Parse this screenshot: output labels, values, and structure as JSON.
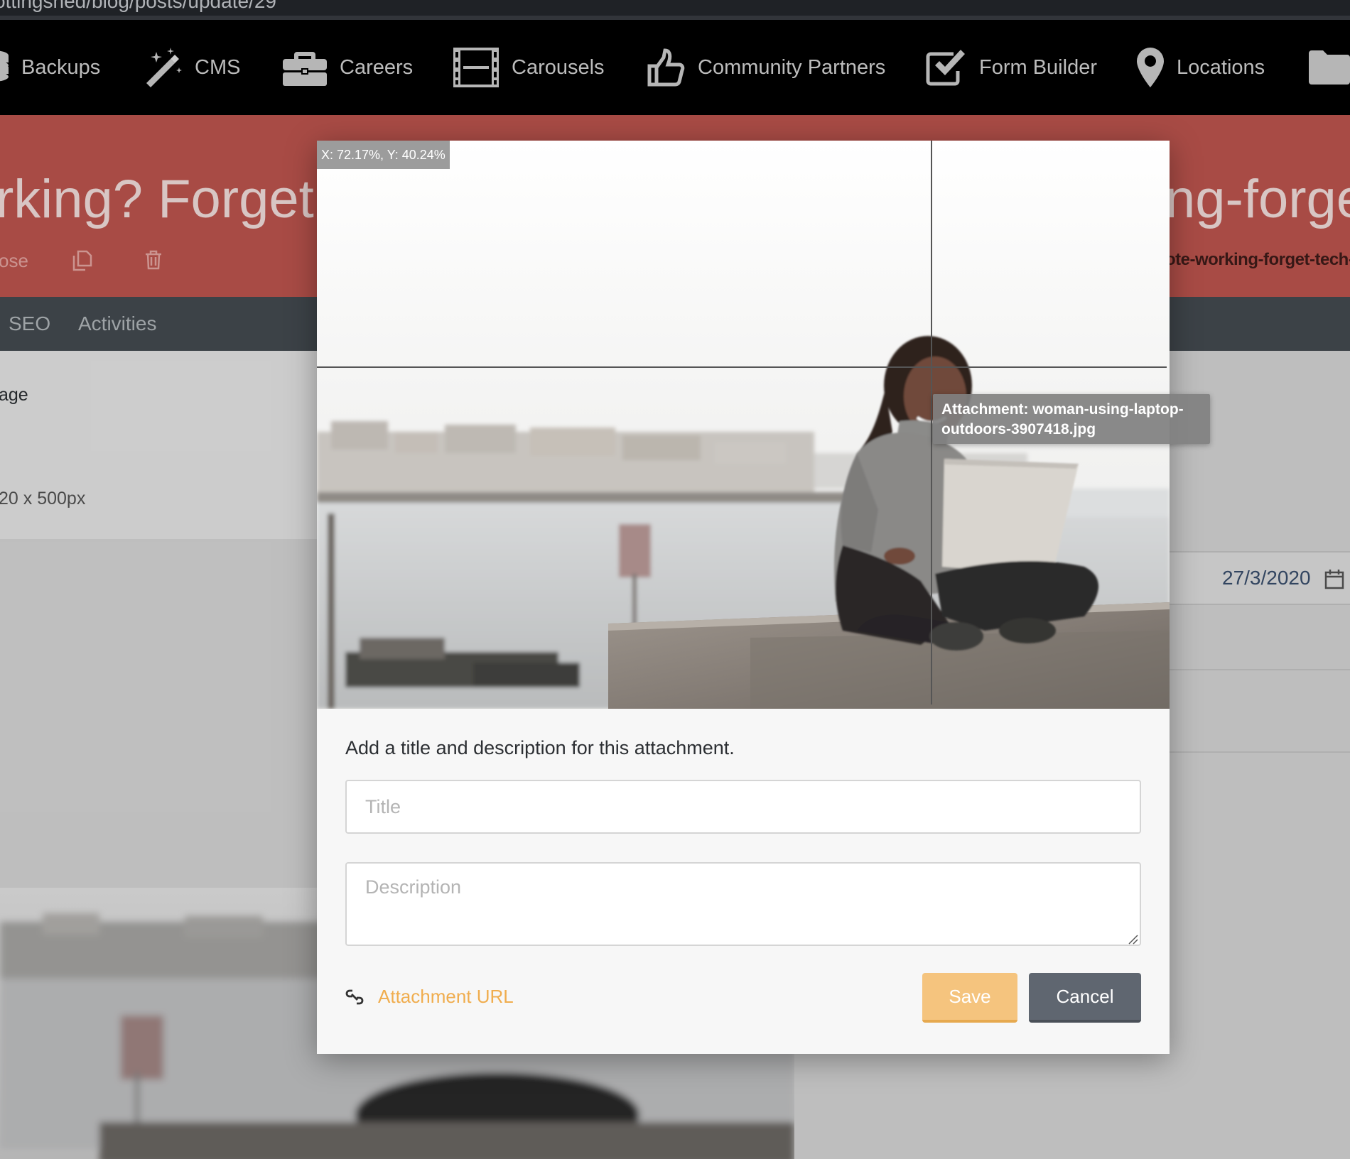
{
  "browser": {
    "url_fragment": "ottingshed/blog/posts/update/29"
  },
  "nav": {
    "items": [
      {
        "label": "Backups",
        "icon": "database-icon"
      },
      {
        "label": "CMS",
        "icon": "magic-wand-icon"
      },
      {
        "label": "Careers",
        "icon": "briefcase-icon"
      },
      {
        "label": "Carousels",
        "icon": "film-icon"
      },
      {
        "label": "Community Partners",
        "icon": "thumbs-up-icon"
      },
      {
        "label": "Form Builder",
        "icon": "checkbox-icon"
      },
      {
        "label": "Locations",
        "icon": "map-pin-icon"
      },
      {
        "label": "",
        "icon": "folder-icon"
      }
    ]
  },
  "header": {
    "title_left": "rking? Forget t",
    "title_right": "ng-forget",
    "close_partial": "ose",
    "slug_partial": "ote-working-forget-tech-t"
  },
  "tabs": [
    {
      "label": "SEO"
    },
    {
      "label": "Activities"
    }
  ],
  "left_panel": {
    "label_partial": "age",
    "size_hint": "20 x 500px"
  },
  "right_panel": {
    "date": "27/3/2020"
  },
  "modal": {
    "coords": "X: 72.17%, Y: 40.24%",
    "tooltip": "Attachment: woman-using-laptop-outdoors-3907418.jpg",
    "prompt": "Add a title and description for this attachment.",
    "title_placeholder": "Title",
    "description_placeholder": "Description",
    "attachment_url_label": "Attachment URL",
    "save_label": "Save",
    "cancel_label": "Cancel"
  },
  "colors": {
    "header_red": "#c0564f",
    "tab_bar": "#454c51",
    "save_button": "#f5c47e",
    "cancel_button": "#5f6670",
    "link": "#f0ad4e"
  }
}
